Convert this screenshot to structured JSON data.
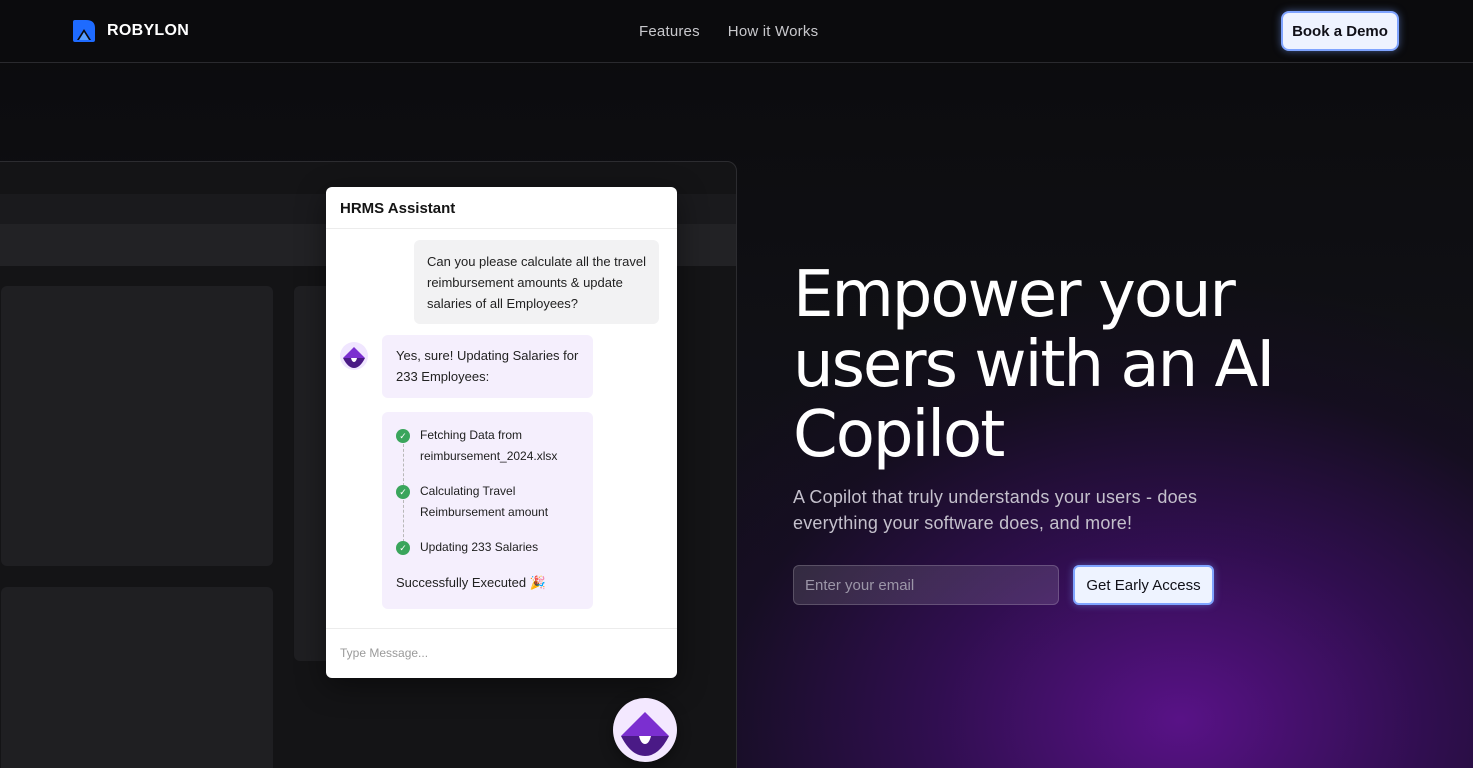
{
  "nav": {
    "brand": "ROBYLON",
    "links": [
      "Features",
      "How it Works"
    ],
    "cta": "Book a Demo"
  },
  "chat": {
    "title": "HRMS Assistant",
    "user_message": "Can you please calculate all the travel reimbursement amounts & update salaries of all Employees?",
    "bot_message": "Yes, sure! Updating Salaries for 233 Employees:",
    "steps": [
      "Fetching Data from reimbursement_2024.xlsx",
      "Calculating Travel Reimbursement amount",
      "Updating 233 Salaries"
    ],
    "success": "Successfully Executed 🎉",
    "input_placeholder": "Type Message..."
  },
  "hero": {
    "headline": "Empower your users with an AI Copilot",
    "subhead": "A Copilot that truly understands your users - does everything your software does, and more!",
    "email_placeholder": "Enter your email",
    "cta": "Get Early Access"
  },
  "colors": {
    "accent_purple": "#7b2fd0",
    "button_bg": "#eef3ff",
    "button_border": "#7fa4ff",
    "check_green": "#3aa55c"
  },
  "icons": {
    "brand_logo": "robylon-logo-icon",
    "bot_avatar": "bot-avatar-icon",
    "step_check": "check-circle-icon",
    "chat_fab": "chat-launcher-icon"
  }
}
